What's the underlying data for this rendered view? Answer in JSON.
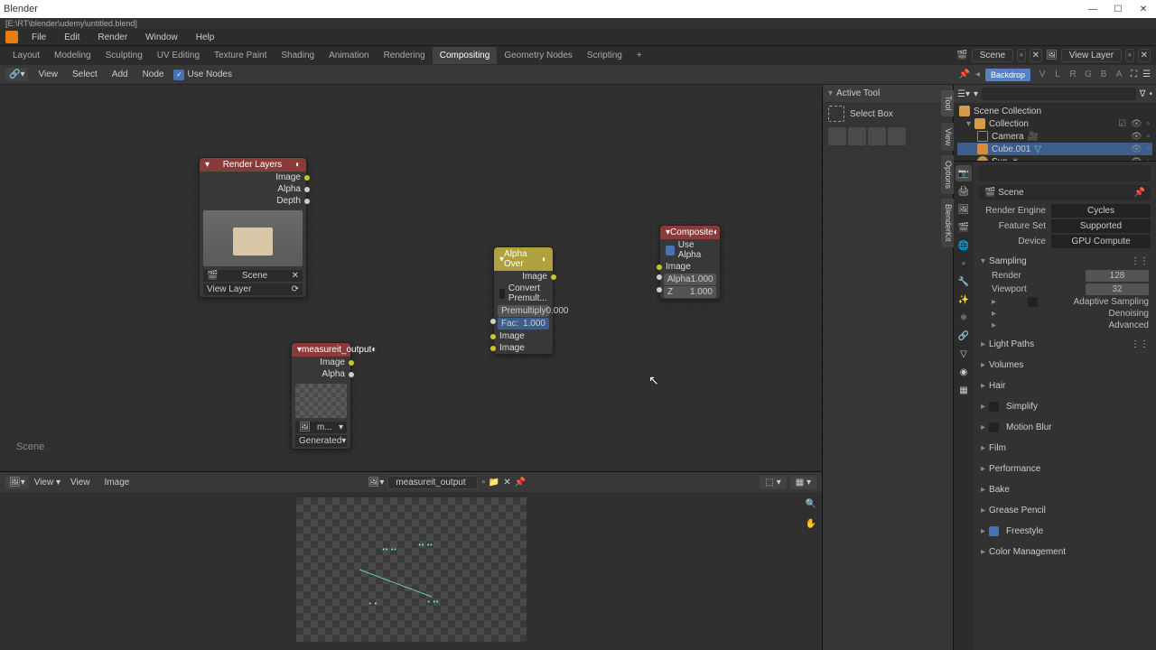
{
  "window": {
    "title": "Blender",
    "path": "[E:\\RT\\blender\\udemy\\untitled.blend]"
  },
  "menubar": [
    "File",
    "Edit",
    "Render",
    "Window",
    "Help"
  ],
  "workspaces": [
    "Layout",
    "Modeling",
    "Sculpting",
    "UV Editing",
    "Texture Paint",
    "Shading",
    "Animation",
    "Rendering",
    "Compositing",
    "Geometry Nodes",
    "Scripting"
  ],
  "ws_active": "Compositing",
  "scene_chip": "Scene",
  "viewlayer_chip": "View Layer",
  "node_toolbar": {
    "menus": [
      "View",
      "Select",
      "Add",
      "Node"
    ],
    "use_nodes": "Use Nodes",
    "backdrop": "Backdrop",
    "channels": [
      "V",
      "L",
      "R",
      "G",
      "B",
      "A"
    ]
  },
  "nodes": {
    "render_layers": {
      "title": "Render Layers",
      "outs": [
        "Image",
        "Alpha",
        "Depth"
      ],
      "droprows": [
        "Scene",
        "View Layer"
      ]
    },
    "measureit": {
      "title": "measureit_output",
      "outs": [
        "Image",
        "Alpha"
      ],
      "img_label": "m...",
      "type_label": "Generated"
    },
    "alpha_over": {
      "title": "Alpha Over",
      "out": "Image",
      "convert": "Convert Premult...",
      "premult": "Premultiply",
      "premult_val": "0.000",
      "fac_label": "Fac:",
      "fac": "1.000",
      "in1": "Image",
      "in2": "Image"
    },
    "composite": {
      "title": "Composite",
      "chk": "Use Alpha",
      "in": "Image",
      "alpha_label": "Alpha",
      "alpha": "1.000",
      "z_label": "Z",
      "z": "1.000"
    }
  },
  "scene_label": "Scene",
  "image_editor": {
    "menus": [
      "View",
      "View",
      "Image"
    ],
    "img": "measureit_output"
  },
  "sidebar_n": {
    "active_tool": "Active Tool",
    "select_box": "Select Box",
    "tabs": [
      "Tool",
      "View",
      "Options",
      "BlenderKit"
    ]
  },
  "outliner": {
    "root": "Scene Collection",
    "collection": "Collection",
    "items": [
      "Camera",
      "Cube.001",
      "Sun"
    ]
  },
  "properties": {
    "scene_path": "Scene",
    "render_engine_label": "Render Engine",
    "render_engine": "Cycles",
    "feature_set_label": "Feature Set",
    "feature_set": "Supported",
    "device_label": "Device",
    "device": "GPU Compute",
    "sampling_hdr": "Sampling",
    "render_label": "Render",
    "render_samples": "128",
    "viewport_label": "Viewport",
    "viewport_samples": "32",
    "subsecs": [
      "Adaptive Sampling",
      "Denoising",
      "Advanced"
    ],
    "panels": [
      "Light Paths",
      "Volumes",
      "Hair",
      "Simplify",
      "Motion Blur",
      "Film",
      "Performance",
      "Bake",
      "Grease Pencil",
      "Freestyle",
      "Color Management"
    ]
  }
}
